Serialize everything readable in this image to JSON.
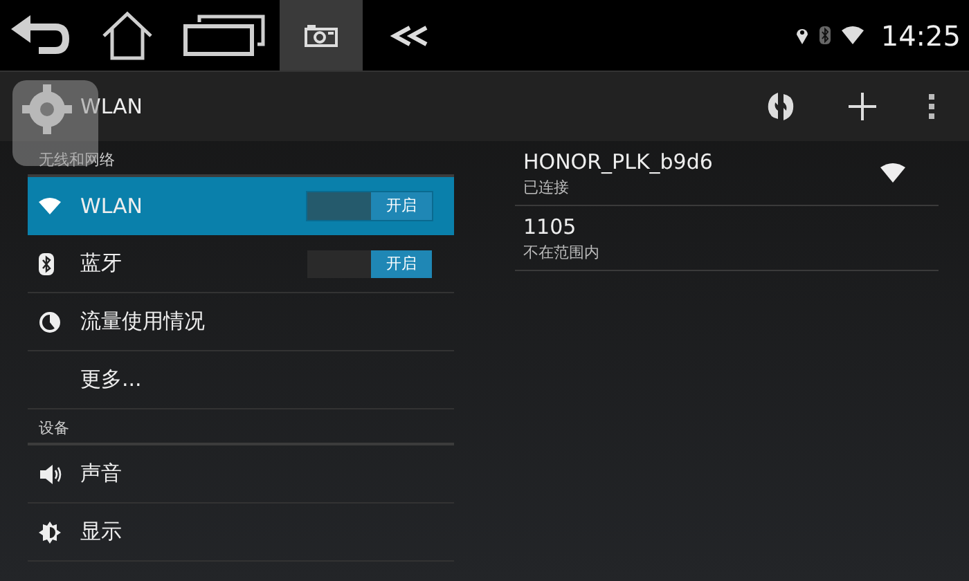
{
  "status_bar": {
    "time": "14:25"
  },
  "action_bar": {
    "title": "WLAN"
  },
  "sidebar": {
    "sections": [
      {
        "header": "无线和网络",
        "items": [
          {
            "label": "WLAN",
            "selected": true,
            "switch": {
              "label": "开启",
              "on": true
            }
          },
          {
            "label": "蓝牙",
            "selected": false,
            "switch": {
              "label": "开启",
              "on": true
            }
          },
          {
            "label": "流量使用情况",
            "selected": false
          },
          {
            "label": "更多...",
            "selected": false
          }
        ]
      },
      {
        "header": "设备",
        "items": [
          {
            "label": "声音",
            "selected": false
          },
          {
            "label": "显示",
            "selected": false
          }
        ]
      }
    ]
  },
  "networks": [
    {
      "ssid": "HONOR_PLK_b9d6",
      "status": "已连接",
      "connected": true
    },
    {
      "ssid": "1105",
      "status": "不在范围内",
      "connected": false
    }
  ]
}
